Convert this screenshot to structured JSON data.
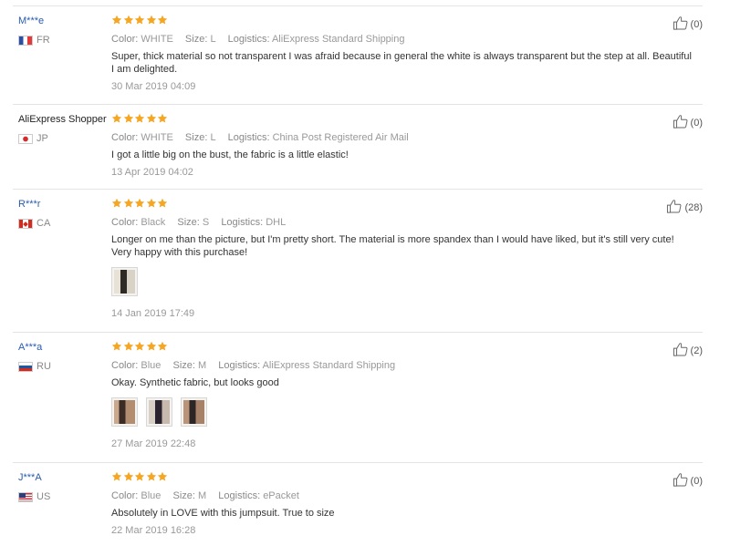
{
  "reviews": [
    {
      "user": "M***e",
      "country": "FR",
      "flag": "fr",
      "stars": 5,
      "color_label": "Color:",
      "color": "WHITE",
      "size_label": "Size:",
      "size": "L",
      "logistics_label": "Logistics:",
      "logistics": "AliExpress Standard Shipping",
      "text": "Super, thick material so not transparent I was afraid because in general the white is always transparent but the step at all. Beautiful I am delighted.",
      "date": "30 Mar 2019 04:09",
      "likes": "(0)",
      "photos": 0
    },
    {
      "user": "AliExpress Shopper",
      "country": "JP",
      "flag": "jp",
      "stars": 5,
      "color_label": "Color:",
      "color": "WHITE",
      "size_label": "Size:",
      "size": "L",
      "logistics_label": "Logistics:",
      "logistics": "China Post Registered Air Mail",
      "text": "I got a little big on the bust, the fabric is a little elastic!",
      "date": "13 Apr 2019 04:02",
      "likes": "(0)",
      "photos": 0
    },
    {
      "user": "R***r",
      "country": "CA",
      "flag": "ca",
      "stars": 5,
      "color_label": "Color:",
      "color": "Black",
      "size_label": "Size:",
      "size": "S",
      "logistics_label": "Logistics:",
      "logistics": "DHL",
      "text": "Longer on me than the picture, but I'm pretty short. The material is more spandex than I would have liked, but it's still very cute! Very happy with this purchase!",
      "date": "14 Jan 2019 17:49",
      "likes": "(28)",
      "photos": 1
    },
    {
      "user": "A***a",
      "country": "RU",
      "flag": "ru",
      "stars": 5,
      "color_label": "Color:",
      "color": "Blue",
      "size_label": "Size:",
      "size": "M",
      "logistics_label": "Logistics:",
      "logistics": "AliExpress Standard Shipping",
      "text": "Okay. Synthetic fabric, but looks good",
      "date": "27 Mar 2019 22:48",
      "likes": "(2)",
      "photos": 3
    },
    {
      "user": "J***A",
      "country": "US",
      "flag": "us",
      "stars": 5,
      "color_label": "Color:",
      "color": "Blue",
      "size_label": "Size:",
      "size": "M",
      "logistics_label": "Logistics:",
      "logistics": "ePacket",
      "text": "Absolutely in LOVE with this jumpsuit. True to size",
      "date": "22 Mar 2019 16:28",
      "likes": "(0)",
      "photos": 0
    }
  ],
  "colors": {
    "star": "#f5a623",
    "username": "#2a5cad",
    "border": "#e4e4e4",
    "muted": "#999999"
  }
}
